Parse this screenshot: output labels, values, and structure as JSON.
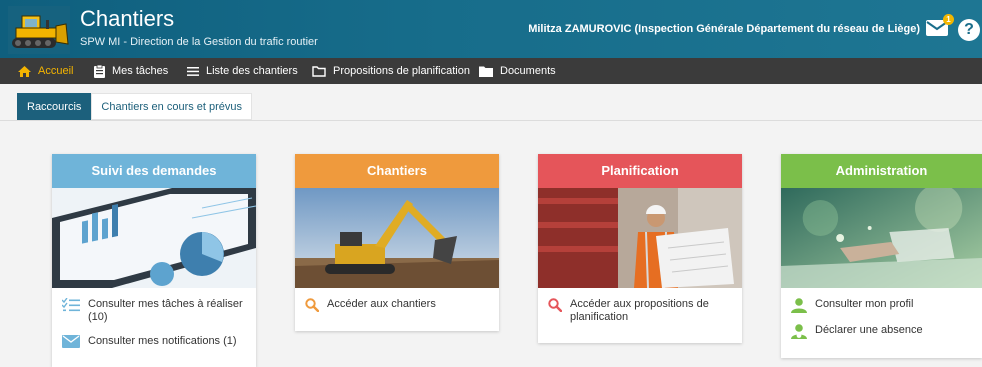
{
  "header": {
    "title": "Chantiers",
    "subtitle": "SPW MI - Direction de la Gestion du trafic routier",
    "user": "Militza ZAMUROVIC (Inspection Générale Département du réseau de Liège)",
    "notifications_badge": "1",
    "help_label": "?"
  },
  "nav": {
    "items": [
      {
        "label": "Accueil",
        "icon": "home-icon"
      },
      {
        "label": "Mes tâches",
        "icon": "clipboard-icon"
      },
      {
        "label": "Liste des chantiers",
        "icon": "list-icon"
      },
      {
        "label": "Propositions de planification",
        "icon": "folder-outline-icon"
      },
      {
        "label": "Documents",
        "icon": "folder-icon"
      }
    ]
  },
  "tabs": [
    {
      "label": "Raccourcis"
    },
    {
      "label": "Chantiers en cours et prévus"
    }
  ],
  "cards": [
    {
      "title": "Suivi des demandes",
      "color": "#6fb4d9",
      "links": [
        {
          "label": "Consulter mes tâches à réaliser (10)",
          "icon": "task-list-icon"
        },
        {
          "label": "Consulter mes notifications (1)",
          "icon": "envelope-icon"
        }
      ]
    },
    {
      "title": "Chantiers",
      "color": "#ef9a3d",
      "links": [
        {
          "label": "Accéder aux chantiers",
          "icon": "search-icon"
        }
      ]
    },
    {
      "title": "Planification",
      "color": "#e5555a",
      "links": [
        {
          "label": "Accéder aux propositions de planification",
          "icon": "search-icon"
        }
      ]
    },
    {
      "title": "Administration",
      "color": "#7bbf4a",
      "links": [
        {
          "label": "Consulter mon profil",
          "icon": "user-icon"
        },
        {
          "label": "Déclarer une absence",
          "icon": "user-absence-icon"
        }
      ]
    }
  ]
}
